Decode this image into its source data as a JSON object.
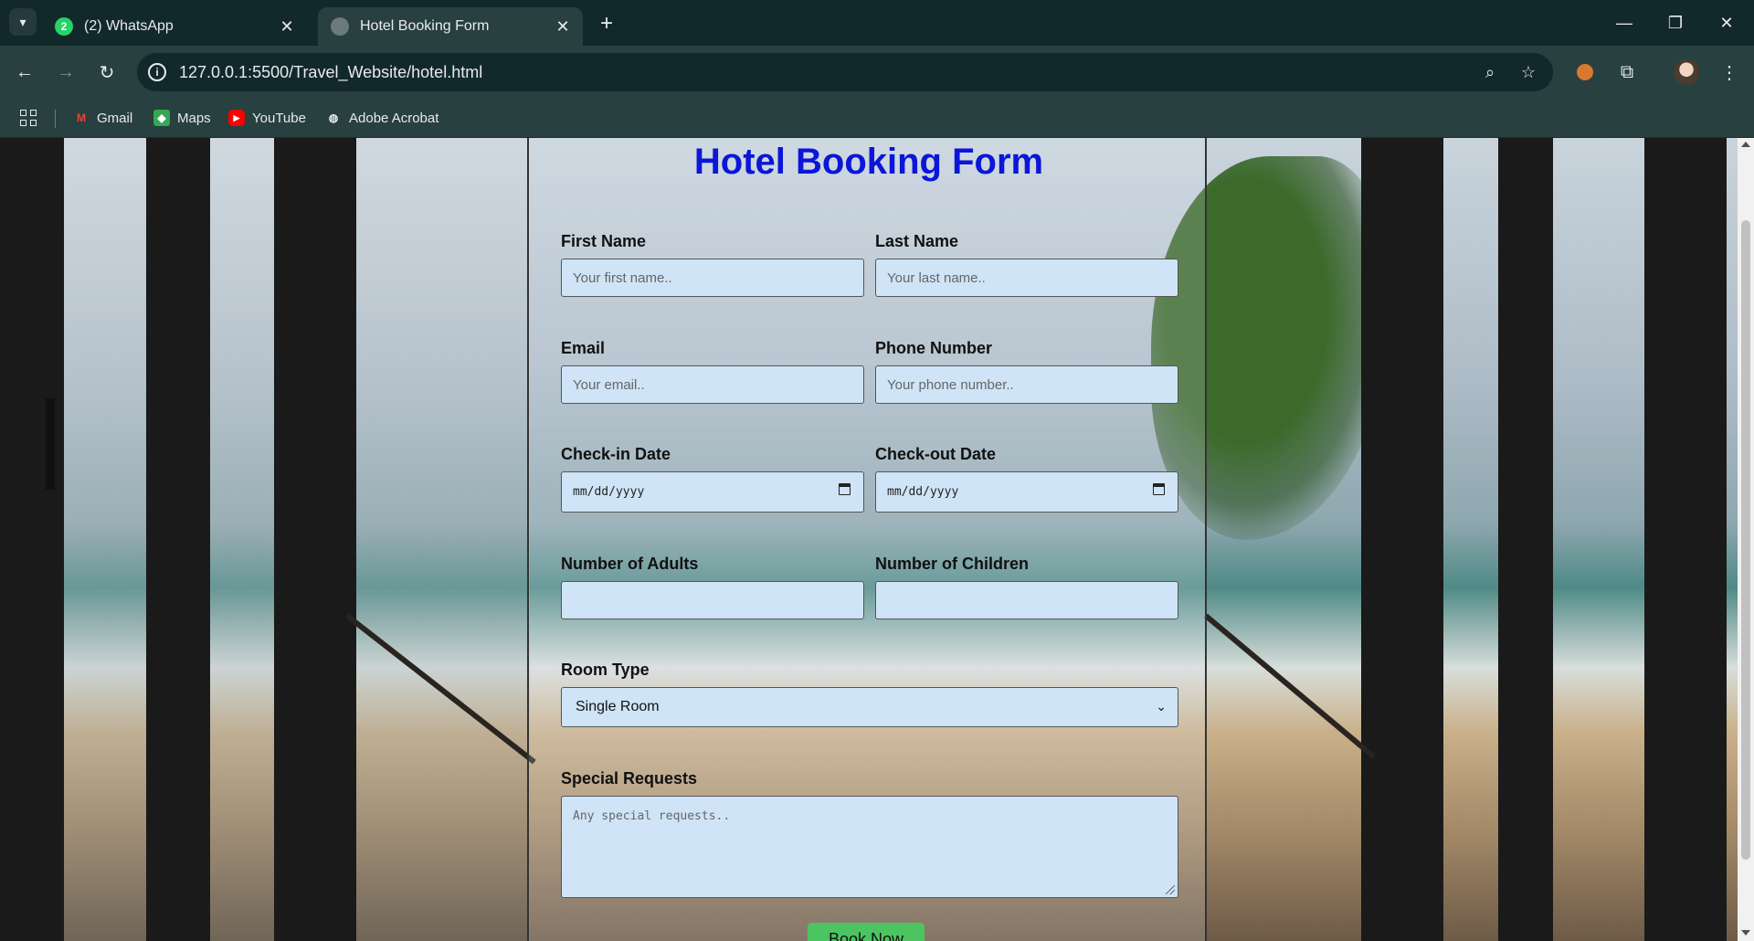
{
  "browser": {
    "tabs": [
      {
        "label": "(2) WhatsApp",
        "badge": "2",
        "active": false
      },
      {
        "label": "Hotel Booking Form",
        "active": true
      }
    ],
    "url": "127.0.0.1:5500/Travel_Website/hotel.html",
    "bookmarks": [
      {
        "label": "Gmail",
        "icon": "gmail-icon"
      },
      {
        "label": "Maps",
        "icon": "maps-icon"
      },
      {
        "label": "YouTube",
        "icon": "youtube-icon"
      },
      {
        "label": "Adobe Acrobat",
        "icon": "globe-icon"
      }
    ]
  },
  "form": {
    "title": "Hotel Booking Form",
    "first_name": {
      "label": "First Name",
      "placeholder": "Your first name.."
    },
    "last_name": {
      "label": "Last Name",
      "placeholder": "Your last name.."
    },
    "email": {
      "label": "Email",
      "placeholder": "Your email.."
    },
    "phone": {
      "label": "Phone Number",
      "placeholder": "Your phone number.."
    },
    "checkin": {
      "label": "Check-in Date",
      "value": "mm/dd/yyyy"
    },
    "checkout": {
      "label": "Check-out Date",
      "value": "mm/dd/yyyy"
    },
    "adults": {
      "label": "Number of Adults",
      "value": ""
    },
    "children": {
      "label": "Number of Children",
      "value": ""
    },
    "room_type": {
      "label": "Room Type",
      "selected": "Single Room"
    },
    "special": {
      "label": "Special Requests",
      "placeholder": "Any special requests.."
    },
    "submit_label": "Book Now"
  },
  "colors": {
    "title": "#0b16d9",
    "input_bg": "#cfe4f6",
    "button_bg": "#4cc462",
    "chrome_dark": "#12292c",
    "chrome_toolbar": "#28403f"
  }
}
